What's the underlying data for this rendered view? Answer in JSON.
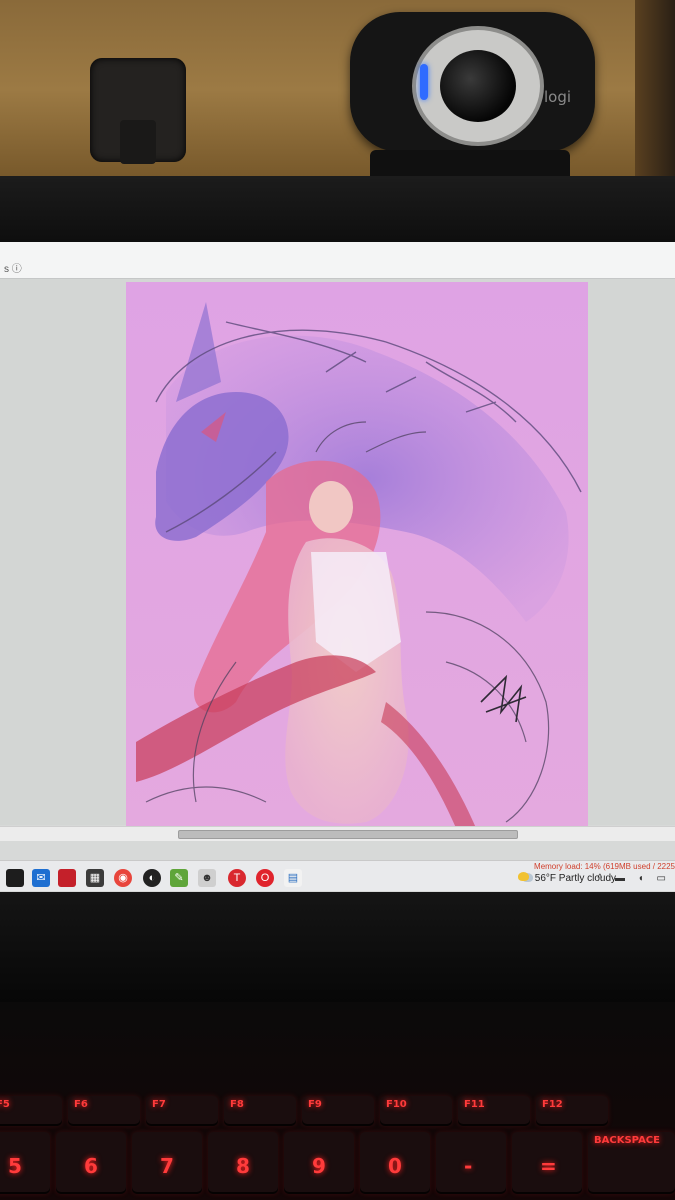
{
  "scene": {
    "webcam_brand": "logi"
  },
  "screen": {
    "title_icon": "s ⓘ",
    "memory_status": "Memory load: 14% (619MB used / 2225",
    "taskbar": {
      "weather_temp": "56°F",
      "weather_desc": "Partly cloudy",
      "apps": [
        {
          "name": "file-app-icon"
        },
        {
          "name": "mail-icon"
        },
        {
          "name": "red-app-icon"
        },
        {
          "name": "calculator-icon"
        },
        {
          "name": "chrome-icon"
        },
        {
          "name": "obs-icon"
        },
        {
          "name": "paint-tool-icon"
        },
        {
          "name": "art-app-icon"
        },
        {
          "name": "red-t-icon"
        },
        {
          "name": "opera-icon"
        },
        {
          "name": "document-icon"
        }
      ],
      "tray_icons": "^ ▬ ◖ ▭"
    }
  },
  "keyboard": {
    "fkeys": [
      "F5",
      "F6",
      "F7",
      "F8",
      "F9",
      "F10",
      "F11",
      "F12"
    ],
    "number_keys": [
      "5",
      "6",
      "7",
      "8",
      "9",
      "0",
      "-",
      "="
    ],
    "backspace": "BACKSPACE"
  },
  "colors": {
    "artwork_background": "#e1a2e0",
    "keyboard_backlight": "#ff3b3b",
    "screen_chrome": "#d7d9d8"
  }
}
